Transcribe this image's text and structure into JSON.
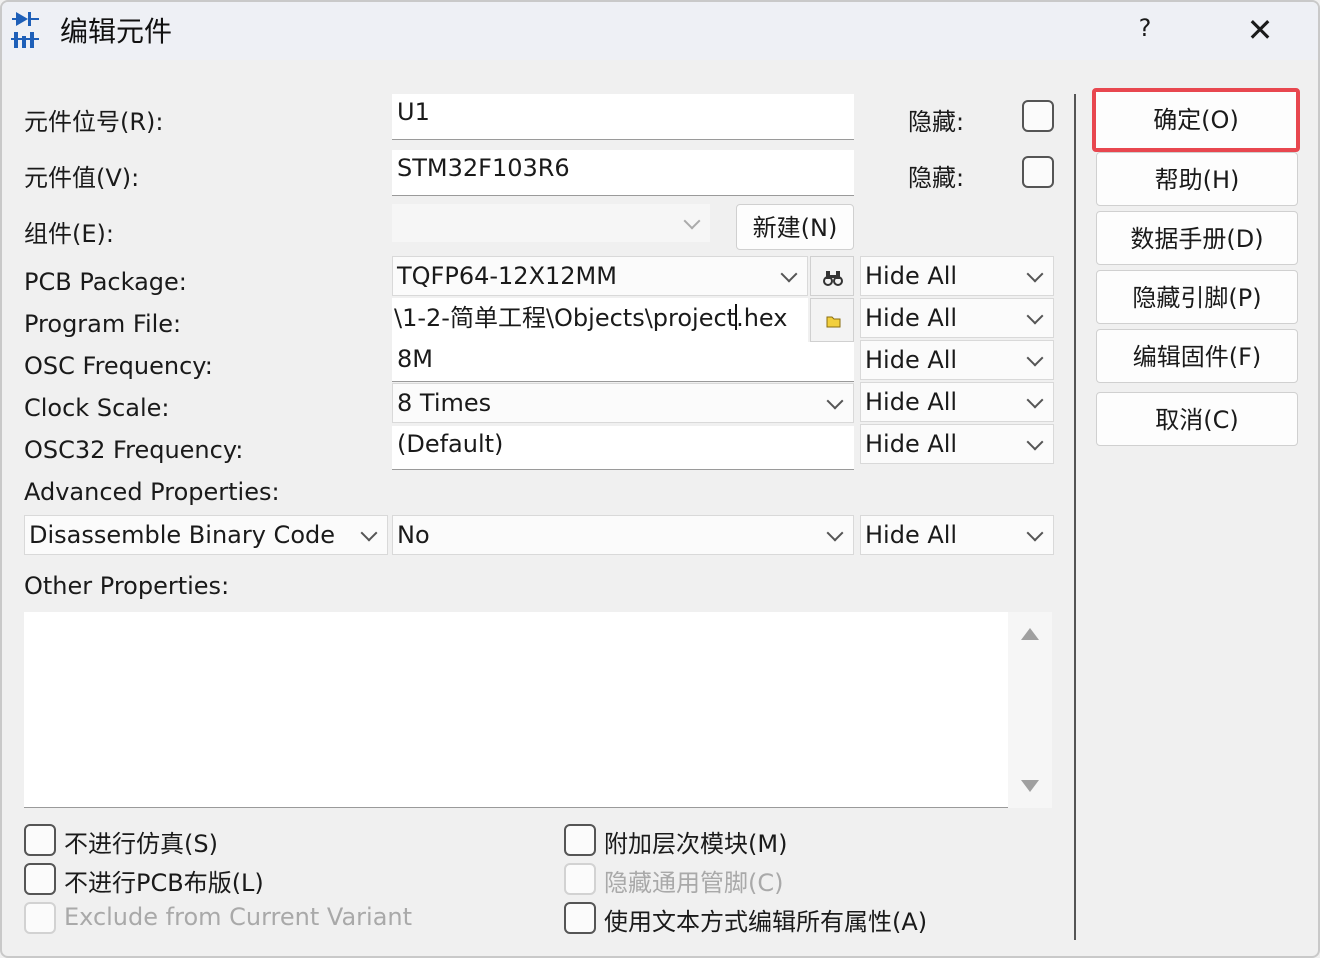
{
  "window": {
    "title": "编辑元件",
    "help_label": "?",
    "close_label": "✕"
  },
  "fields": {
    "ref_label": "元件位号(R):",
    "ref_value": "U1",
    "ref_hidden_label": "隐藏:",
    "value_label": "元件值(V):",
    "value_value": "STM32F103R6",
    "value_hidden_label": "隐藏:",
    "group_label": "组件(E):",
    "group_value": "",
    "new_label": "新建(N)"
  },
  "properties": [
    {
      "label": "PCB Package:",
      "value": "TQFP64-12X12MM",
      "visibility": "Hide All"
    },
    {
      "label": "Program File:",
      "value_pre": "\\1-2-简单工程\\Objects\\project",
      "value_post": ".hex",
      "visibility": "Hide All"
    },
    {
      "label": "OSC Frequency:",
      "value": "8M",
      "visibility": "Hide All"
    },
    {
      "label": "Clock Scale:",
      "value": "8 Times",
      "visibility": "Hide All"
    },
    {
      "label": "OSC32 Frequency:",
      "value": "(Default)",
      "visibility": "Hide All"
    }
  ],
  "advanced": {
    "label": "Advanced Properties:",
    "property": "Disassemble Binary Code",
    "value": "No",
    "visibility": "Hide All"
  },
  "other": {
    "label": "Other Properties:",
    "text": ""
  },
  "checkboxes": {
    "no_sim": "不进行仿真(S)",
    "no_pcb": "不进行PCB布版(L)",
    "exclude_variant": "Exclude from Current Variant",
    "attach_module": "附加层次模块(M)",
    "hide_common_pins": "隐藏通用管脚(C)",
    "edit_all_text": "使用文本方式编辑所有属性(A)"
  },
  "buttons": {
    "ok": "确定(O)",
    "help": "帮助(H)",
    "datasheet": "数据手册(D)",
    "hidden_pins": "隐藏引脚(P)",
    "edit_firmware": "编辑固件(F)",
    "cancel": "取消(C)"
  },
  "colors": {
    "ok_highlight": "#e8474f",
    "titlebar": "#eef0f5"
  }
}
